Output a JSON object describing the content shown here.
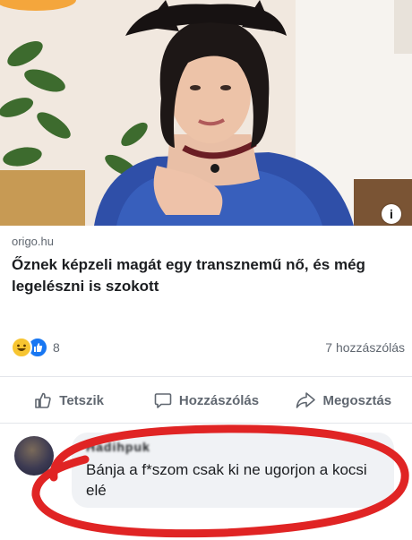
{
  "post": {
    "source": "origo.hu",
    "headline": "Őznek képzeli magát egy transznemű nő, és még legelészni is szokott",
    "info_icon": "i"
  },
  "reactions": {
    "icons": [
      "haha-icon",
      "like-icon"
    ],
    "count": "8",
    "comments": "7 hozzászólás"
  },
  "actions": {
    "like_label": "Tetszik",
    "comment_label": "Hozzászólás",
    "share_label": "Megosztás"
  },
  "comment": {
    "author": "Hadihpuk",
    "text": "Bánja a f*szom csak ki ne ugorjon a kocsi elé"
  },
  "colors": {
    "annotation_red": "#e02424",
    "like_blue": "#1877f2",
    "haha_yellow": "#f7c531"
  }
}
